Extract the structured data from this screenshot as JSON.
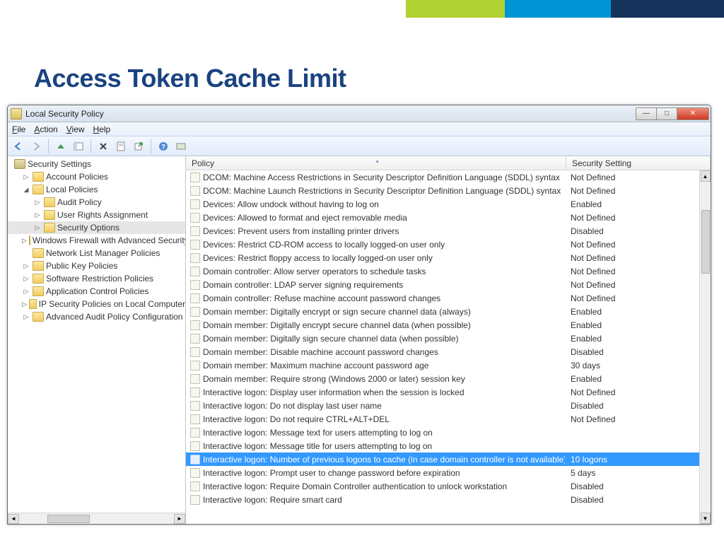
{
  "slide_title": "Access Token Cache Limit",
  "window_title": "Local Security Policy",
  "menus": {
    "file": "File",
    "action": "Action",
    "view": "View",
    "help": "Help"
  },
  "tree_root": "Security Settings",
  "tree": [
    {
      "label": "Account Policies",
      "indent": 1,
      "expanded": false,
      "selected": false
    },
    {
      "label": "Local Policies",
      "indent": 1,
      "expanded": true,
      "selected": false
    },
    {
      "label": "Audit Policy",
      "indent": 2,
      "expanded": false,
      "selected": false
    },
    {
      "label": "User Rights Assignment",
      "indent": 2,
      "expanded": false,
      "selected": false
    },
    {
      "label": "Security Options",
      "indent": 2,
      "expanded": false,
      "selected": true
    },
    {
      "label": "Windows Firewall with Advanced Security",
      "indent": 1,
      "expanded": false,
      "selected": false
    },
    {
      "label": "Network List Manager Policies",
      "indent": 1,
      "expanded": null,
      "selected": false
    },
    {
      "label": "Public Key Policies",
      "indent": 1,
      "expanded": false,
      "selected": false
    },
    {
      "label": "Software Restriction Policies",
      "indent": 1,
      "expanded": false,
      "selected": false
    },
    {
      "label": "Application Control Policies",
      "indent": 1,
      "expanded": false,
      "selected": false
    },
    {
      "label": "IP Security Policies on Local Computer",
      "indent": 1,
      "expanded": false,
      "selected": false,
      "special": true
    },
    {
      "label": "Advanced Audit Policy Configuration",
      "indent": 1,
      "expanded": false,
      "selected": false
    }
  ],
  "columns": {
    "policy": "Policy",
    "setting": "Security Setting"
  },
  "policies": [
    {
      "name": "DCOM: Machine Access Restrictions in Security Descriptor Definition Language (SDDL) syntax",
      "setting": "Not Defined",
      "selected": false
    },
    {
      "name": "DCOM: Machine Launch Restrictions in Security Descriptor Definition Language (SDDL) syntax",
      "setting": "Not Defined",
      "selected": false
    },
    {
      "name": "Devices: Allow undock without having to log on",
      "setting": "Enabled",
      "selected": false
    },
    {
      "name": "Devices: Allowed to format and eject removable media",
      "setting": "Not Defined",
      "selected": false
    },
    {
      "name": "Devices: Prevent users from installing printer drivers",
      "setting": "Disabled",
      "selected": false
    },
    {
      "name": "Devices: Restrict CD-ROM access to locally logged-on user only",
      "setting": "Not Defined",
      "selected": false
    },
    {
      "name": "Devices: Restrict floppy access to locally logged-on user only",
      "setting": "Not Defined",
      "selected": false
    },
    {
      "name": "Domain controller: Allow server operators to schedule tasks",
      "setting": "Not Defined",
      "selected": false
    },
    {
      "name": "Domain controller: LDAP server signing requirements",
      "setting": "Not Defined",
      "selected": false
    },
    {
      "name": "Domain controller: Refuse machine account password changes",
      "setting": "Not Defined",
      "selected": false
    },
    {
      "name": "Domain member: Digitally encrypt or sign secure channel data (always)",
      "setting": "Enabled",
      "selected": false
    },
    {
      "name": "Domain member: Digitally encrypt secure channel data (when possible)",
      "setting": "Enabled",
      "selected": false
    },
    {
      "name": "Domain member: Digitally sign secure channel data (when possible)",
      "setting": "Enabled",
      "selected": false
    },
    {
      "name": "Domain member: Disable machine account password changes",
      "setting": "Disabled",
      "selected": false
    },
    {
      "name": "Domain member: Maximum machine account password age",
      "setting": "30 days",
      "selected": false
    },
    {
      "name": "Domain member: Require strong (Windows 2000 or later) session key",
      "setting": "Enabled",
      "selected": false
    },
    {
      "name": "Interactive logon: Display user information when the session is locked",
      "setting": "Not Defined",
      "selected": false
    },
    {
      "name": "Interactive logon: Do not display last user name",
      "setting": "Disabled",
      "selected": false
    },
    {
      "name": "Interactive logon: Do not require CTRL+ALT+DEL",
      "setting": "Not Defined",
      "selected": false
    },
    {
      "name": "Interactive logon: Message text for users attempting to log on",
      "setting": "",
      "selected": false
    },
    {
      "name": "Interactive logon: Message title for users attempting to log on",
      "setting": "",
      "selected": false
    },
    {
      "name": "Interactive logon: Number of previous logons to cache (in case domain controller is not available)",
      "setting": "10 logons",
      "selected": true
    },
    {
      "name": "Interactive logon: Prompt user to change password before expiration",
      "setting": "5 days",
      "selected": false
    },
    {
      "name": "Interactive logon: Require Domain Controller authentication to unlock workstation",
      "setting": "Disabled",
      "selected": false
    },
    {
      "name": "Interactive logon: Require smart card",
      "setting": "Disabled",
      "selected": false
    }
  ]
}
